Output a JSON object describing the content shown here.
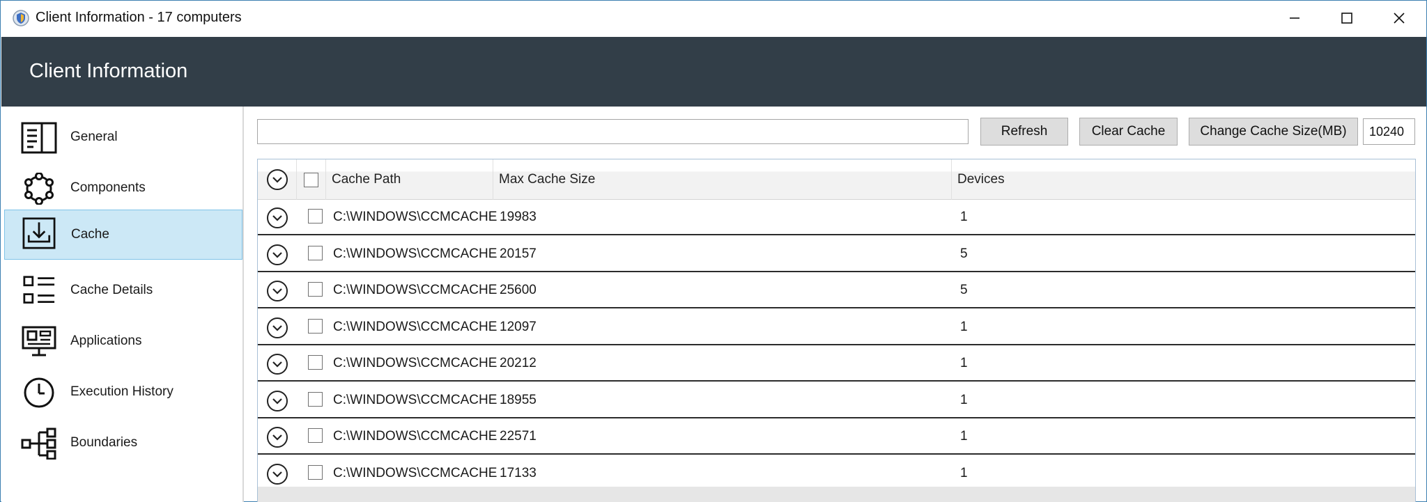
{
  "window": {
    "title": "Client Information - 17 computers"
  },
  "header": {
    "title": "Client Information"
  },
  "sidebar": {
    "items": [
      {
        "label": "General",
        "icon": "document-list-icon"
      },
      {
        "label": "Components",
        "icon": "components-ring-icon"
      },
      {
        "label": "Cache",
        "icon": "download-tray-icon",
        "active": true
      },
      {
        "label": "Cache Details",
        "icon": "checklist-icon"
      },
      {
        "label": "Applications",
        "icon": "monitor-apps-icon"
      },
      {
        "label": "Execution History",
        "icon": "clock-icon"
      },
      {
        "label": "Boundaries",
        "icon": "hierarchy-icon"
      }
    ]
  },
  "toolbar": {
    "search_value": "",
    "refresh_label": "Refresh",
    "clear_cache_label": "Clear Cache",
    "change_cache_label": "Change Cache Size(MB)",
    "cache_size_value": "10240"
  },
  "grid": {
    "columns": {
      "path": "Cache Path",
      "max": "Max Cache Size",
      "devices": "Devices"
    },
    "rows": [
      {
        "path": "C:\\WINDOWS\\CCMCACHE",
        "max": "19983",
        "devices": "1"
      },
      {
        "path": "C:\\WINDOWS\\CCMCACHE",
        "max": "20157",
        "devices": "5"
      },
      {
        "path": "C:\\WINDOWS\\CCMCACHE",
        "max": "25600",
        "devices": "5"
      },
      {
        "path": "C:\\WINDOWS\\CCMCACHE",
        "max": "12097",
        "devices": "1"
      },
      {
        "path": "C:\\WINDOWS\\CCMCACHE",
        "max": "20212",
        "devices": "1"
      },
      {
        "path": "C:\\WINDOWS\\CCMCACHE",
        "max": "18955",
        "devices": "1"
      },
      {
        "path": "C:\\WINDOWS\\CCMCACHE",
        "max": "22571",
        "devices": "1"
      },
      {
        "path": "C:\\WINDOWS\\CCMCACHE",
        "max": "17133",
        "devices": "1"
      }
    ]
  },
  "colors": {
    "header_bg": "#323e48",
    "active_nav_bg": "#cce8f6",
    "active_nav_border": "#7fc3e8"
  }
}
